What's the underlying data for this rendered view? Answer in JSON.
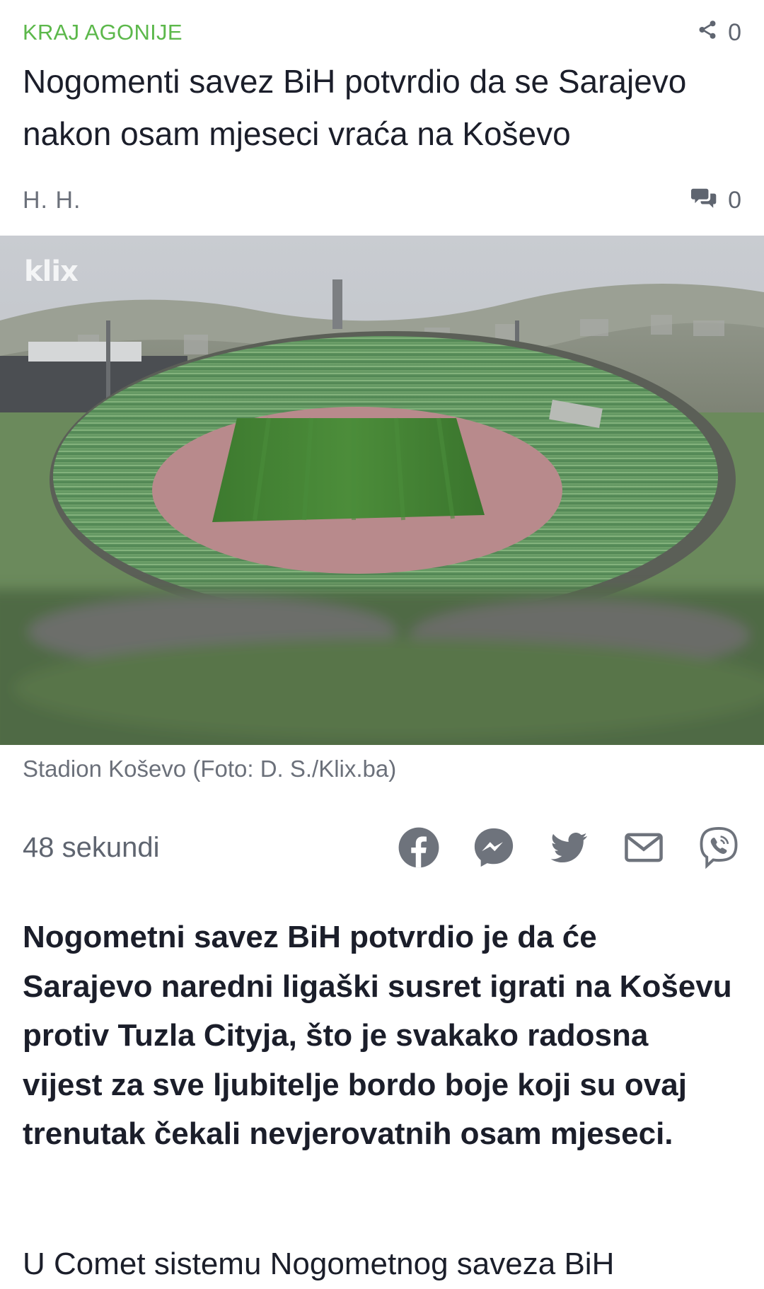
{
  "article": {
    "kicker": "KRAJ AGONIJE",
    "share_count": "0",
    "headline": "Nogomenti savez BiH potvrdio da se Sarajevo nakon osam mjeseci vraća na Koševo",
    "author": "H. H.",
    "comment_count": "0",
    "image": {
      "watermark": "klix",
      "caption": "Stadion Koševo (Foto: D. S./Klix.ba)"
    },
    "read_time": "48 sekundi",
    "lead": "Nogometni savez BiH potvrdio je da će Sarajevo naredni ligaški susret igrati na Koševu protiv Tuzla Cityja, što je svakako radosna vijest za sve ljubitelje bordo boje koji su ovaj trenutak čekali nevjerovatnih osam mjeseci.",
    "body_start": "U Comet sistemu Nogometnog saveza BiH"
  },
  "share_buttons": [
    {
      "name": "facebook",
      "icon": "facebook-icon"
    },
    {
      "name": "messenger",
      "icon": "messenger-icon"
    },
    {
      "name": "twitter",
      "icon": "twitter-icon"
    },
    {
      "name": "email",
      "icon": "mail-icon"
    },
    {
      "name": "viber",
      "icon": "viber-icon"
    }
  ],
  "colors": {
    "kicker_green": "#5cb84b",
    "text_dark": "#1b1e2a",
    "text_muted": "#6b707a",
    "icon_gray": "#6e737c"
  }
}
